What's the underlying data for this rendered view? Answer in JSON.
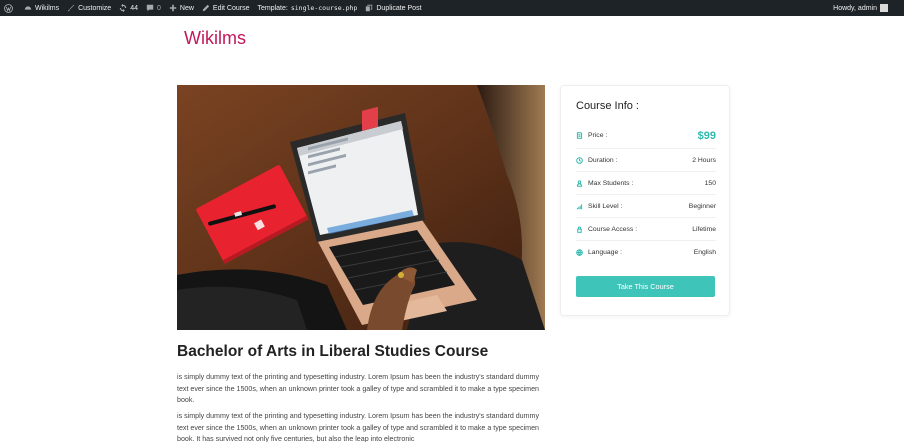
{
  "admin_bar": {
    "site_name": "Wikilms",
    "customize": "Customize",
    "updates_count": "44",
    "comments_count": "0",
    "new_label": "New",
    "edit_course": "Edit Course",
    "template_label": "Template:",
    "template_file": "single-course.php",
    "duplicate_post": "Duplicate Post",
    "howdy": "Howdy, admin"
  },
  "site": {
    "title": "Wikilms"
  },
  "course": {
    "title": "Bachelor of Arts in Liberal Studies Course",
    "paragraph_1": " is simply dummy text of the printing and typesetting industry. Lorem Ipsum has been the industry's standard dummy text ever since the 1500s, when an unknown printer took a galley of type and scrambled it to make a type specimen book.",
    "paragraph_2": " is simply dummy text of the printing and typesetting industry. Lorem Ipsum has been the industry's standard dummy text ever since the 1500s, when an unknown printer took a galley of type and scrambled it to make a type specimen book. It has survived not only five centuries, but also the leap into electronic"
  },
  "course_info": {
    "heading": "Course Info :",
    "price_label": "Price :",
    "price_value": "$99",
    "duration_label": "Duration :",
    "duration_value": "2 Hours",
    "max_students_label": "Max Students :",
    "max_students_value": "150",
    "skill_level_label": "Skill Level :",
    "skill_level_value": "Beginner",
    "access_label": "Course Access :",
    "access_value": "Lifetime",
    "language_label": "Language :",
    "language_value": "English",
    "cta_label": "Take This Course",
    "accent_color": "#3fc4ba"
  }
}
